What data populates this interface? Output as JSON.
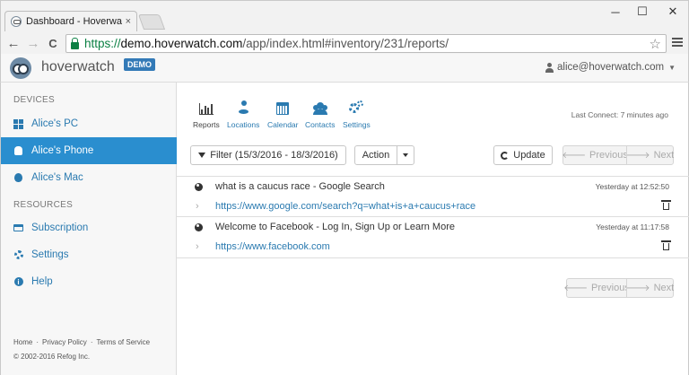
{
  "browser": {
    "tab_title": "Dashboard - Hoverwatch",
    "tab_close": "×",
    "url_scheme": "https://",
    "url_host": "demo.hoverwatch.com",
    "url_path": "/app/index.html#inventory/231/reports/",
    "back": "←",
    "forward": "→",
    "reload": "C",
    "star": "☆",
    "minimize": "─",
    "maximize": "☐",
    "close": "✕"
  },
  "header": {
    "brand": "hoverwatch",
    "badge": "DEMO",
    "user_email": "alice@hoverwatch.com",
    "user_caret": "▼"
  },
  "sidebar": {
    "devices_heading": "DEVICES",
    "devices": [
      {
        "label": "Alice's PC",
        "icon": "windows-icon"
      },
      {
        "label": "Alice's Phone",
        "icon": "android-icon",
        "active": true
      },
      {
        "label": "Alice's Mac",
        "icon": "apple-icon"
      }
    ],
    "resources_heading": "RESOURCES",
    "resources": [
      {
        "label": "Subscription",
        "icon": "credit-card-icon"
      },
      {
        "label": "Settings",
        "icon": "gear-icon"
      },
      {
        "label": "Help",
        "icon": "info-icon",
        "glyph": "i"
      }
    ],
    "footer": {
      "home": "Home",
      "dot1": "·",
      "privacy": "Privacy Policy",
      "dot2": "·",
      "terms": "Terms of Service",
      "copyright": "© 2002-2016 Refog Inc."
    }
  },
  "toolbar": {
    "items": [
      {
        "label": "Reports",
        "icon": "bar-chart-icon"
      },
      {
        "label": "Locations",
        "icon": "map-pin-icon"
      },
      {
        "label": "Calendar",
        "icon": "calendar-icon"
      },
      {
        "label": "Contacts",
        "icon": "contacts-icon"
      },
      {
        "label": "Settings",
        "icon": "gears-icon"
      }
    ],
    "last_connect": "Last Connect: 7 minutes ago"
  },
  "controls": {
    "filter_label": "Filter (15/3/2016 - 18/3/2016)",
    "action_label": "Action",
    "update_label": "Update",
    "previous_label": "Previous",
    "next_label": "Next",
    "prev_arrow": "🡐",
    "next_arrow": "🡒"
  },
  "history": [
    {
      "title": "what is a caucus race - Google Search",
      "time": "Yesterday at 12:52:50",
      "url": "https://www.google.com/search?q=what+is+a+caucus+race"
    },
    {
      "title": "Welcome to Facebook - Log In, Sign Up or Learn More",
      "time": "Yesterday at 11:17:58",
      "url": "https://www.facebook.com"
    }
  ],
  "pagination_bottom": {
    "previous_label": "Previous",
    "next_label": "Next"
  },
  "colors": {
    "accent": "#2a8ecf",
    "link": "#2a7ab0",
    "secure": "#0b8043",
    "badge": "#337ab7"
  }
}
